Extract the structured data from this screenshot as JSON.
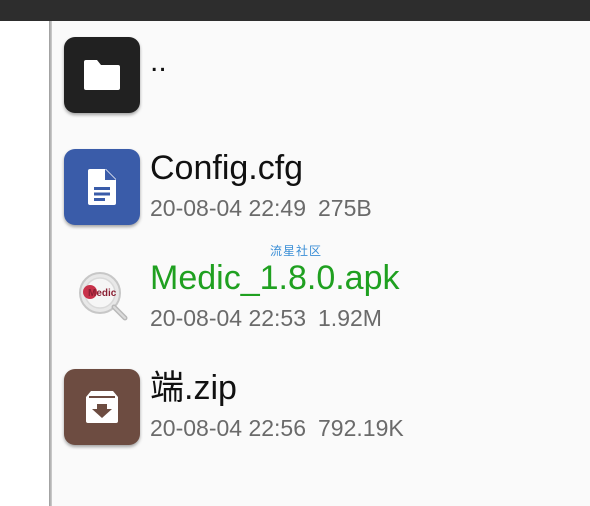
{
  "files": [
    {
      "name": "..",
      "date": "",
      "size": "",
      "icon": "folder-icon",
      "tile_color": "#212121",
      "name_color": "#111111"
    },
    {
      "name": "Config.cfg",
      "date": "20-08-04 22:49",
      "size": "275B",
      "icon": "document-icon",
      "tile_color": "#3a5ca9",
      "name_color": "#111111"
    },
    {
      "name": "Medic_1.8.0.apk",
      "date": "20-08-04 22:53",
      "size": "1.92M",
      "icon": "medic-app-icon",
      "icon_text": "Medic",
      "name_color": "#1fa020"
    },
    {
      "name": "端.zip",
      "date": "20-08-04 22:56",
      "size": "792.19K",
      "icon": "archive-icon",
      "tile_color": "#6d4c41",
      "name_color": "#111111"
    }
  ],
  "watermark": "流星社区",
  "colors": {
    "topbar": "#2d2d2d",
    "background": "#fafafa",
    "meta_text": "#6a6a6a",
    "apk_name": "#1fa020"
  }
}
